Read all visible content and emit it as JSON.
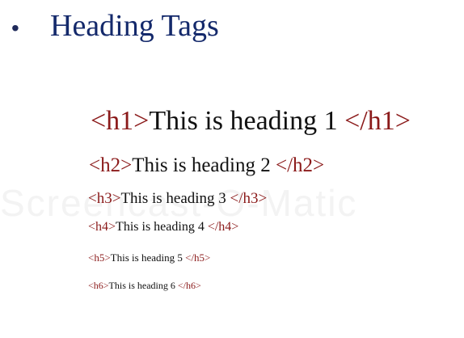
{
  "slide": {
    "bullet": "•",
    "title": "Heading Tags",
    "watermark": "Screencast-O-Matic"
  },
  "headings": [
    {
      "open_tag": "<h1>",
      "text": "This is heading 1 ",
      "close_tag": "</h1>"
    },
    {
      "open_tag": "<h2>",
      "text": "This is heading 2 ",
      "close_tag": "</h2>"
    },
    {
      "open_tag": "<h3>",
      "text": "This is heading 3 ",
      "close_tag": "</h3>"
    },
    {
      "open_tag": "<h4>",
      "text": "This is heading 4 ",
      "close_tag": "</h4>"
    },
    {
      "open_tag": "<h5>",
      "text": "This is heading 5 ",
      "close_tag": "</h5>"
    },
    {
      "open_tag": "<h6>",
      "text": "This is heading 6 ",
      "close_tag": "</h6>"
    }
  ],
  "colors": {
    "title": "#14296b",
    "tag": "#8b1a1a",
    "text": "#111111"
  }
}
